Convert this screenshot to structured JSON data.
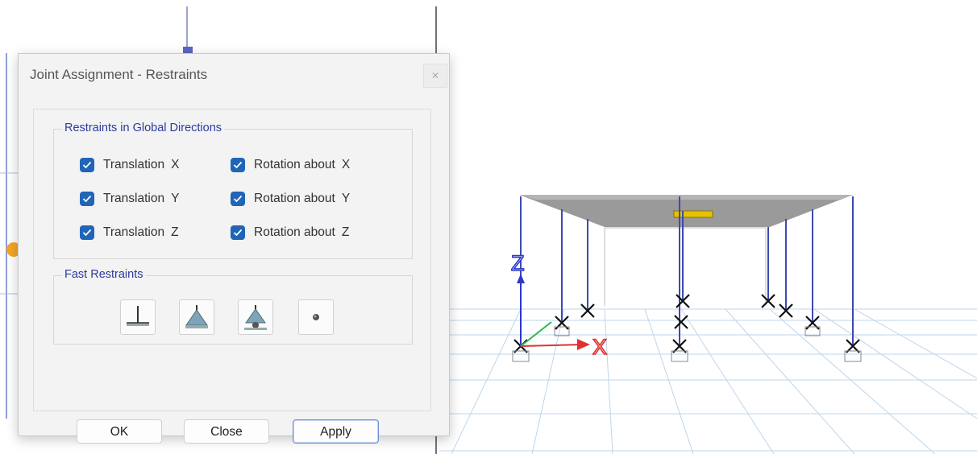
{
  "dialog": {
    "title": "Joint Assignment - Restraints",
    "restraints_group": {
      "legend": "Restraints in Global Directions",
      "items": [
        {
          "name": "Translation",
          "axis": "X",
          "checked": true
        },
        {
          "name": "Translation",
          "axis": "Y",
          "checked": true
        },
        {
          "name": "Translation",
          "axis": "Z",
          "checked": true
        },
        {
          "name": "Rotation about",
          "axis": "X",
          "checked": true
        },
        {
          "name": "Rotation about",
          "axis": "Y",
          "checked": true
        },
        {
          "name": "Rotation about",
          "axis": "Z",
          "checked": true
        }
      ]
    },
    "fast_restraints": {
      "legend": "Fast Restraints",
      "icons": [
        "fixed-support-icon",
        "pinned-support-icon",
        "roller-support-icon",
        "free-joint-icon"
      ]
    },
    "buttons": {
      "ok": "OK",
      "close": "Close",
      "apply": "Apply"
    }
  },
  "viewport": {
    "axis_labels": {
      "z": "Z",
      "x": "X"
    },
    "colors": {
      "z_axis": "#2b38c9",
      "x_axis": "#e03030",
      "y_axis": "#2db84a",
      "grid": "#bcd6ee",
      "column": "#3b4bb0"
    }
  }
}
